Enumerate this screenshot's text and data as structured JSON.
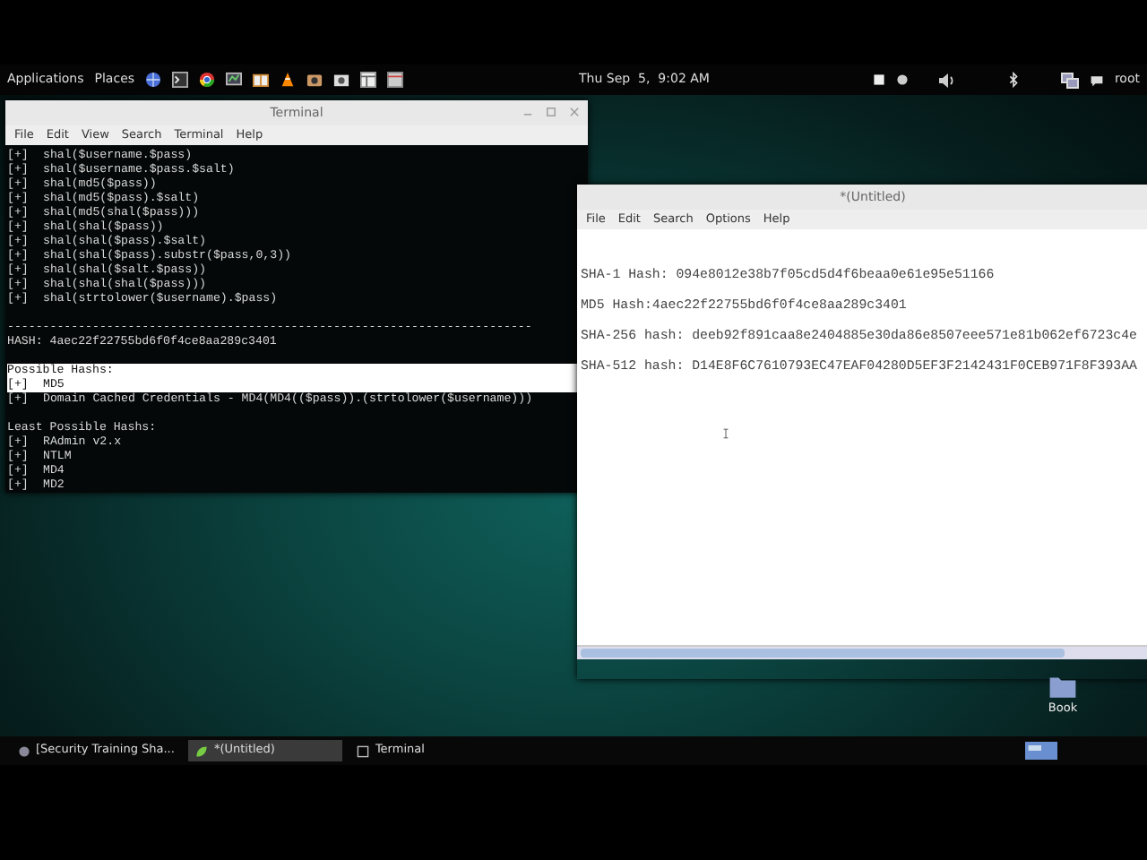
{
  "top_panel": {
    "menus": [
      "Applications",
      "Places"
    ],
    "clock": "Thu Sep  5,  9:02 AM",
    "user": "root"
  },
  "terminal": {
    "title": "Terminal",
    "menu": [
      "File",
      "Edit",
      "View",
      "Search",
      "Terminal",
      "Help"
    ],
    "blocks": [
      {
        "lines": [
          {
            "marker": "[+]",
            "text": "shal($username.$pass)",
            "highlighted": false
          },
          {
            "marker": "[+]",
            "text": "shal($username.$pass.$salt)",
            "highlighted": false
          },
          {
            "marker": "[+]",
            "text": "shal(md5($pass))",
            "highlighted": false
          },
          {
            "marker": "[+]",
            "text": "shal(md5($pass).$salt)",
            "highlighted": false
          },
          {
            "marker": "[+]",
            "text": "shal(md5(shal($pass)))",
            "highlighted": false
          },
          {
            "marker": "[+]",
            "text": "shal(shal($pass))",
            "highlighted": false
          },
          {
            "marker": "[+]",
            "text": "shal(shal($pass).$salt)",
            "highlighted": false
          },
          {
            "marker": "[+]",
            "text": "shal(shal($pass).substr($pass,0,3))",
            "highlighted": false
          },
          {
            "marker": "[+]",
            "text": "shal(shal($salt.$pass))",
            "highlighted": false
          },
          {
            "marker": "[+]",
            "text": "shal(shal(shal($pass)))",
            "highlighted": false
          },
          {
            "marker": "[+]",
            "text": "shal(strtolower($username).$pass)",
            "highlighted": false
          }
        ]
      },
      {
        "lines": [
          {
            "text": "--------------------------------------------------------------------------",
            "highlighted": false
          },
          {
            "text": "HASH: 4aec22f22755bd6f0f4ce8aa289c3401",
            "highlighted": false
          }
        ]
      },
      {
        "lines": [
          {
            "text": "Possible Hashs:",
            "highlighted": true
          },
          {
            "marker": "[+]",
            "text": "MD5",
            "highlighted": true
          },
          {
            "marker": "[+]",
            "text": "Domain Cached Credentials - MD4(MD4(($pass)).(strtolower($username)))",
            "highlighted": false
          }
        ]
      },
      {
        "lines": [
          {
            "text": "Least Possible Hashs:",
            "highlighted": false
          },
          {
            "marker": "[+]",
            "text": "RAdmin v2.x",
            "highlighted": false
          },
          {
            "marker": "[+]",
            "text": "NTLM",
            "highlighted": false
          },
          {
            "marker": "[+]",
            "text": "MD4",
            "highlighted": false
          },
          {
            "marker": "[+]",
            "text": "MD2",
            "highlighted": false
          }
        ]
      }
    ]
  },
  "editor": {
    "title": "*(Untitled)",
    "menu": [
      "File",
      "Edit",
      "Search",
      "Options",
      "Help"
    ],
    "lines": [
      "SHA-1 Hash: 094e8012e38b7f05cd5d4f6beaa0e61e95e51166",
      "MD5 Hash:4aec22f22755bd6f0f4ce8aa289c3401",
      "SHA-256 hash: deeb92f891caa8e2404885e30da86e8507eee571e81b062ef6723c4e",
      "SHA-512 hash: D14E8F6C7610793EC47EAF04280D5EF3F2142431F0CEB971F8F393AA"
    ]
  },
  "desktop_icons": [
    {
      "label": "Book"
    }
  ],
  "taskbar": [
    {
      "label": "[Security Training Sha...",
      "selected": false
    },
    {
      "label": "*(Untitled)",
      "selected": true
    },
    {
      "label": "Terminal",
      "selected": false
    }
  ]
}
